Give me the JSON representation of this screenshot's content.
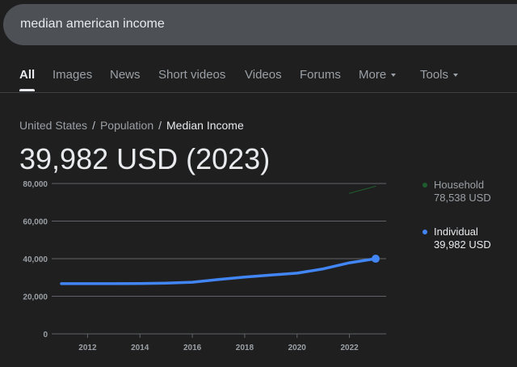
{
  "search": {
    "query": "median american income"
  },
  "tabs": [
    {
      "label": "All",
      "active": true
    },
    {
      "label": "Images"
    },
    {
      "label": "News"
    },
    {
      "label": "Short videos"
    },
    {
      "label": "Videos"
    },
    {
      "label": "Forums"
    },
    {
      "label": "More",
      "dropdown": true
    },
    {
      "label": "Tools",
      "dropdown": true
    }
  ],
  "breadcrumb": [
    "United States",
    "Population",
    "Median Income"
  ],
  "headline": "39,982 USD (2023)",
  "legend": [
    {
      "label": "Household",
      "value": "78,538 USD",
      "color": "#1e5e2e"
    },
    {
      "label": "Individual",
      "value": "39,982 USD",
      "color": "#4285f4"
    }
  ],
  "chart_data": {
    "type": "line",
    "title": "39,982 USD (2023)",
    "xlabel": "",
    "ylabel": "",
    "x_ticks": [
      "2012",
      "2014",
      "2016",
      "2018",
      "2020",
      "2022"
    ],
    "y_ticks": [
      "0",
      "20,000",
      "40,000",
      "60,000",
      "80,000"
    ],
    "xlim": [
      2011,
      2023
    ],
    "ylim": [
      0,
      80000
    ],
    "grid": true,
    "legend_position": "right",
    "series": [
      {
        "name": "Household",
        "color": "#1e5e2e",
        "x": [
          2022,
          2023
        ],
        "values": [
          74800,
          78538
        ]
      },
      {
        "name": "Individual",
        "color": "#4285f4",
        "x": [
          2011,
          2012,
          2013,
          2014,
          2015,
          2016,
          2017,
          2018,
          2019,
          2020,
          2021,
          2022,
          2023
        ],
        "values": [
          26700,
          26700,
          26700,
          26800,
          27000,
          27500,
          28900,
          30200,
          31300,
          32300,
          34600,
          37800,
          39982
        ]
      }
    ]
  }
}
